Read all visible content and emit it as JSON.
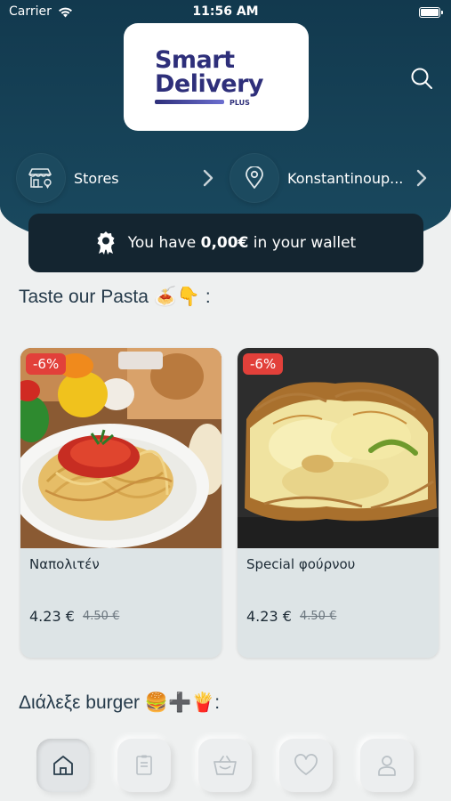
{
  "status_bar": {
    "carrier": "Carrier",
    "time": "11:56 AM"
  },
  "logo": {
    "line1": "Smart",
    "line2": "Delivery",
    "plus": "PLUS"
  },
  "nav": {
    "stores_label": "Stores",
    "location_label": "Konstantinoup..."
  },
  "wallet": {
    "prefix": "You have ",
    "amount": "0,00€",
    "suffix": " in your wallet"
  },
  "sections": [
    {
      "title": "Taste our Pasta 🍝👇 :"
    },
    {
      "title": "Διάλεξε burger 🍔➕🍟:"
    }
  ],
  "products": [
    {
      "badge": "-6%",
      "name": "Ναπολιτέν",
      "price": "4.23 €",
      "old_price": "4.50 €"
    },
    {
      "badge": "-6%",
      "name": "Special φούρνου",
      "price": "4.23 €",
      "old_price": "4.50 €"
    }
  ],
  "tabs": [
    {
      "icon": "home-icon",
      "active": true
    },
    {
      "icon": "orders-icon",
      "active": false
    },
    {
      "icon": "basket-icon",
      "active": false
    },
    {
      "icon": "heart-icon",
      "active": false
    },
    {
      "icon": "profile-icon",
      "active": false
    }
  ],
  "colors": {
    "header": "#12394e",
    "wallet": "#142530",
    "badge": "#e2403a",
    "card": "#dde4e6",
    "logo": "#2e2f7a"
  }
}
